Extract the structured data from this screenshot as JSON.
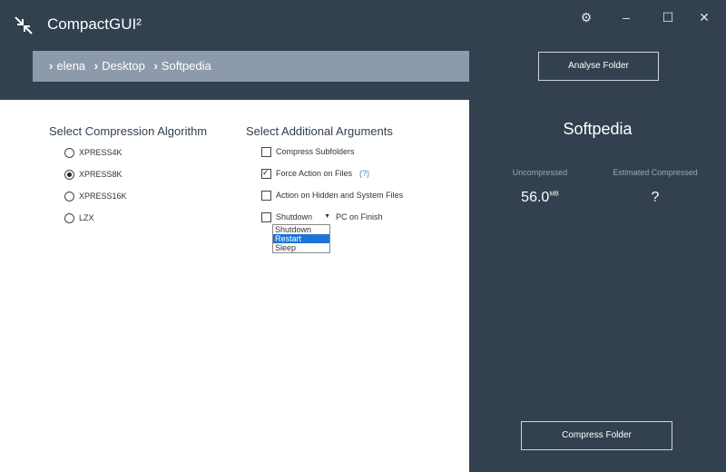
{
  "app": {
    "title": "CompactGUI²"
  },
  "window": {
    "settings_icon": "gear-icon",
    "minimize_icon": "minimize-icon",
    "maximize_icon": "maximize-icon",
    "close_icon": "close-icon"
  },
  "breadcrumb": {
    "items": [
      "elena",
      "Desktop",
      "Softpedia"
    ]
  },
  "toolbar": {
    "analyse_label": "Analyse Folder"
  },
  "compression": {
    "heading": "Select Compression Algorithm",
    "options": [
      "XPRESS4K",
      "XPRESS8K",
      "XPRESS16K",
      "LZX"
    ],
    "selected": "XPRESS8K"
  },
  "arguments": {
    "heading": "Select Additional Arguments",
    "compress_subfolders": {
      "label": "Compress Subfolders",
      "checked": false
    },
    "force_action": {
      "label": "Force Action on Files",
      "checked": true,
      "help": "(?)"
    },
    "hidden_system": {
      "label": "Action on Hidden and System Files",
      "checked": false
    },
    "finish_action": {
      "checked": false,
      "selected": "Shutdown",
      "suffix": "PC on Finish",
      "options": [
        "Shutdown",
        "Restart",
        "Sleep"
      ],
      "highlighted": "Restart"
    }
  },
  "summary": {
    "folder_name": "Softpedia",
    "uncompressed_label": "Uncompressed",
    "uncompressed_value": "56.0",
    "uncompressed_unit": "MB",
    "estimated_label": "Estimated Compressed",
    "estimated_value": "?",
    "compress_label": "Compress Folder"
  }
}
